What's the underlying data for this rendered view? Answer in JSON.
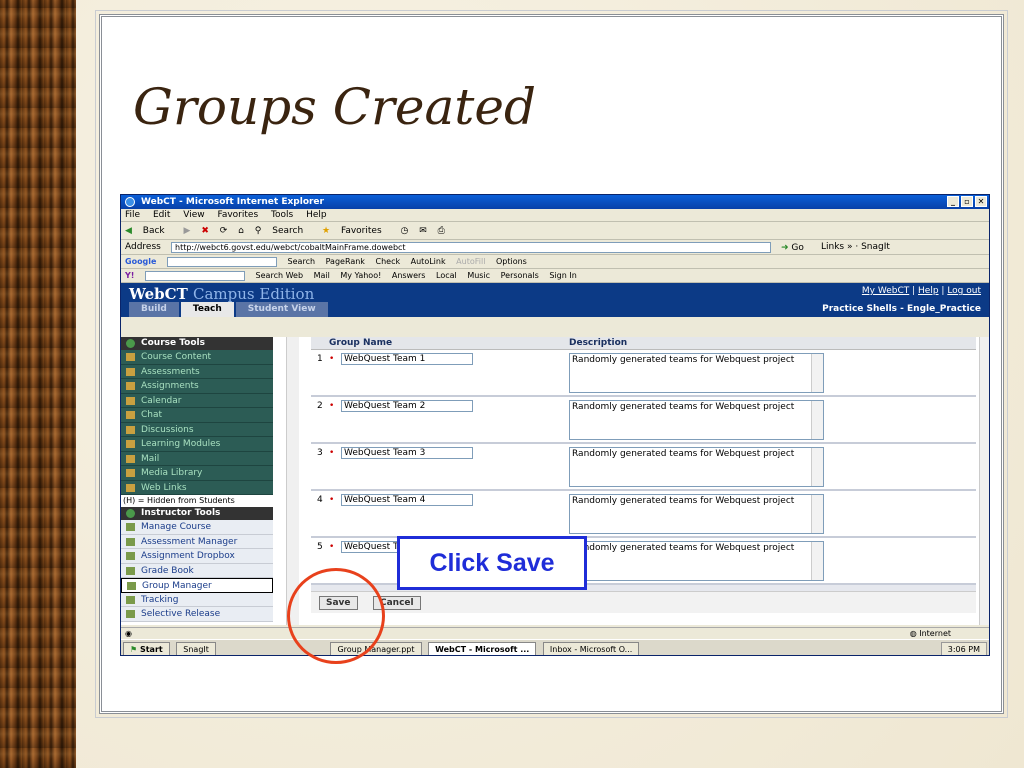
{
  "slide": {
    "title": "Groups Created"
  },
  "window": {
    "title": "WebCT - Microsoft Internet Explorer",
    "menu": [
      "File",
      "Edit",
      "View",
      "Favorites",
      "Tools",
      "Help"
    ],
    "toolbar": [
      "Back",
      "Search",
      "Favorites"
    ],
    "address_label": "Address",
    "address_url": "http://webct6.govst.edu/webct/cobaltMainFrame.dowebct",
    "go": "Go",
    "links": "Links",
    "snagit": "SnagIt",
    "google": "Google",
    "google_items": [
      "Search",
      "PageRank",
      "Check",
      "AutoLink",
      "AutoFill",
      "Options"
    ],
    "yahoo_items": [
      "Search Web",
      "Mail",
      "My Yahoo!",
      "Answers",
      "Local",
      "Music",
      "Personals",
      "Sign In"
    ]
  },
  "webct": {
    "logo_main": "WebCT",
    "logo_sub": "Campus Edition",
    "links": [
      "My WebCT",
      "Help",
      "Log out"
    ],
    "tabs": [
      "Build",
      "Teach",
      "Student View"
    ],
    "context": "Practice Shells - Engle_Practice"
  },
  "course_tools": {
    "heading": "Course Tools",
    "items": [
      "Course Content",
      "Assessments",
      "Assignments",
      "Calendar",
      "Chat",
      "Discussions",
      "Learning Modules",
      "Mail",
      "Media Library",
      "Web Links"
    ],
    "hidden_note": "(H) = Hidden from Students"
  },
  "instructor_tools": {
    "heading": "Instructor Tools",
    "items": [
      "Manage Course",
      "Assessment Manager",
      "Assignment Dropbox",
      "Grade Book",
      "Group Manager",
      "Tracking",
      "Selective Release"
    ]
  },
  "groups": {
    "col_name": "Group Name",
    "col_desc": "Description",
    "rows": [
      {
        "num": "1",
        "name": "WebQuest Team 1",
        "desc": "Randomly generated teams for Webquest project"
      },
      {
        "num": "2",
        "name": "WebQuest Team 2",
        "desc": "Randomly generated teams for Webquest project"
      },
      {
        "num": "3",
        "name": "WebQuest Team 3",
        "desc": "Randomly generated teams for Webquest project"
      },
      {
        "num": "4",
        "name": "WebQuest Team 4",
        "desc": "Randomly generated teams for Webquest project"
      },
      {
        "num": "5",
        "name": "WebQuest Team 5",
        "desc": "Randomly generated teams for Webquest project"
      }
    ],
    "save": "Save",
    "cancel": "Cancel"
  },
  "status": {
    "zone": "Internet"
  },
  "taskbar": {
    "start": "Start",
    "items": [
      "SnagIt",
      "Group Manager.ppt",
      "WebCT - Microsoft ...",
      "Inbox - Microsoft O..."
    ],
    "clock": "3:06 PM"
  },
  "callout": {
    "text": "Click Save"
  }
}
